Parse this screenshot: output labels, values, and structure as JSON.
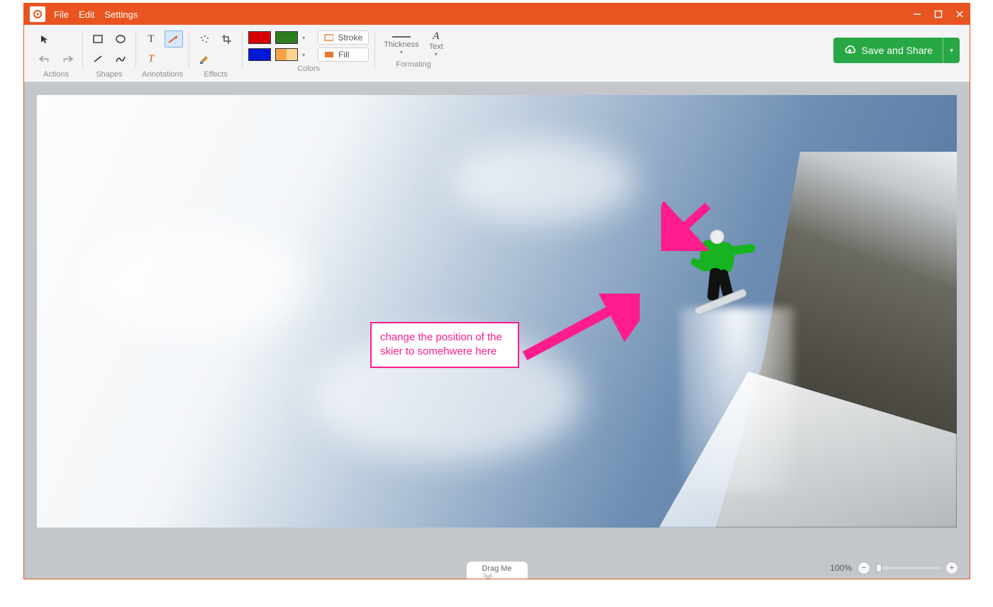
{
  "menu": {
    "file": "File",
    "edit": "Edit",
    "settings": "Settings"
  },
  "ribbon": {
    "groups": {
      "actions": "Actions",
      "shapes": "Shapes",
      "annotations": "Annotations",
      "effects": "Effects",
      "colors": "Colors",
      "formating": "Formating"
    },
    "stroke": "Stroke",
    "fill": "Fill",
    "thickness": "Thickness",
    "text": "Text",
    "swatches": {
      "red": "#d60000",
      "green": "#2e7d1f",
      "blue": "#0018d6",
      "orange": "#f7a24a"
    }
  },
  "save_button": "Save and Share",
  "annotation": {
    "text": "change the position of the skier to somehwere here",
    "color": "#ff1d8e"
  },
  "drag_label": "Drag Me",
  "zoom": {
    "level": "100%"
  }
}
